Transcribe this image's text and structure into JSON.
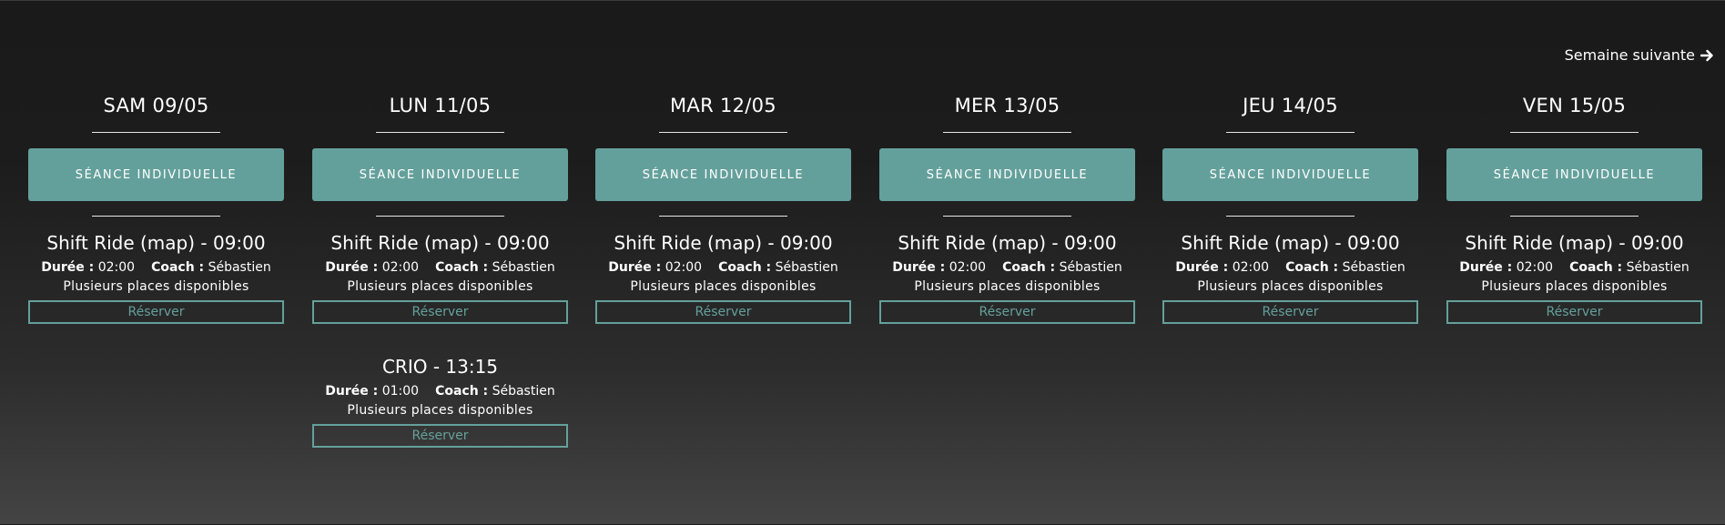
{
  "header": {
    "next_week_label": "Semaine suivante"
  },
  "colors": {
    "accent": "#64a09b",
    "text": "#ffffff",
    "background_top": "#1a1a1a",
    "background_bottom": "#444444"
  },
  "icons": {
    "next_week": "arrow-right-icon"
  },
  "days": [
    {
      "title": "SAM 09/05",
      "seance_label": "SÉANCE INDIVIDUELLE",
      "sessions": [
        {
          "title": "Shift Ride (map) - 09:00",
          "duration_label": "Durée :",
          "duration": "02:00",
          "coach_label": "Coach :",
          "coach": "Sébastien",
          "places": "Plusieurs places disponibles",
          "reserve_label": "Réserver"
        }
      ]
    },
    {
      "title": "LUN 11/05",
      "seance_label": "SÉANCE INDIVIDUELLE",
      "sessions": [
        {
          "title": "Shift Ride (map) - 09:00",
          "duration_label": "Durée :",
          "duration": "02:00",
          "coach_label": "Coach :",
          "coach": "Sébastien",
          "places": "Plusieurs places disponibles",
          "reserve_label": "Réserver"
        },
        {
          "title": "CRIO - 13:15",
          "duration_label": "Durée :",
          "duration": "01:00",
          "coach_label": "Coach :",
          "coach": "Sébastien",
          "places": "Plusieurs places disponibles",
          "reserve_label": "Réserver"
        }
      ]
    },
    {
      "title": "MAR 12/05",
      "seance_label": "SÉANCE INDIVIDUELLE",
      "sessions": [
        {
          "title": "Shift Ride (map) - 09:00",
          "duration_label": "Durée :",
          "duration": "02:00",
          "coach_label": "Coach :",
          "coach": "Sébastien",
          "places": "Plusieurs places disponibles",
          "reserve_label": "Réserver"
        }
      ]
    },
    {
      "title": "MER 13/05",
      "seance_label": "SÉANCE INDIVIDUELLE",
      "sessions": [
        {
          "title": "Shift Ride (map) - 09:00",
          "duration_label": "Durée :",
          "duration": "02:00",
          "coach_label": "Coach :",
          "coach": "Sébastien",
          "places": "Plusieurs places disponibles",
          "reserve_label": "Réserver"
        }
      ]
    },
    {
      "title": "JEU 14/05",
      "seance_label": "SÉANCE INDIVIDUELLE",
      "sessions": [
        {
          "title": "Shift Ride (map) - 09:00",
          "duration_label": "Durée :",
          "duration": "02:00",
          "coach_label": "Coach :",
          "coach": "Sébastien",
          "places": "Plusieurs places disponibles",
          "reserve_label": "Réserver"
        }
      ]
    },
    {
      "title": "VEN 15/05",
      "seance_label": "SÉANCE INDIVIDUELLE",
      "sessions": [
        {
          "title": "Shift Ride (map) - 09:00",
          "duration_label": "Durée :",
          "duration": "02:00",
          "coach_label": "Coach :",
          "coach": "Sébastien",
          "places": "Plusieurs places disponibles",
          "reserve_label": "Réserver"
        }
      ]
    }
  ]
}
